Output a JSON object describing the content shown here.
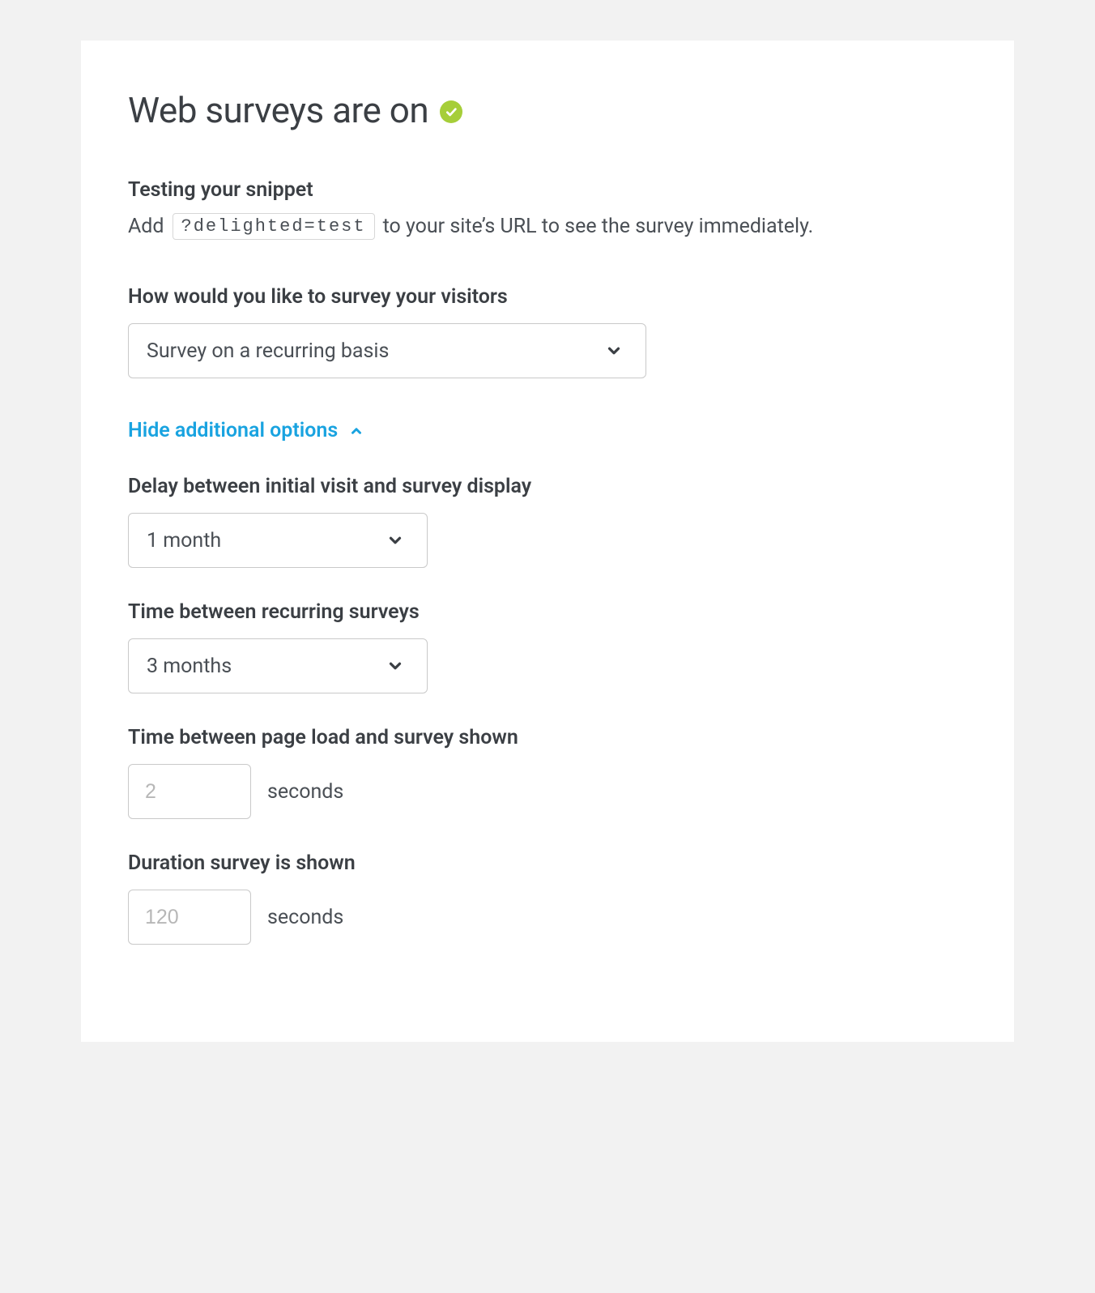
{
  "header": {
    "title": "Web surveys are on"
  },
  "testing": {
    "heading": "Testing your snippet",
    "prefix": "Add",
    "param": "?delighted=test",
    "suffix": "to your site’s URL to see the survey immediately."
  },
  "survey_method": {
    "label": "How would you like to survey your visitors",
    "value": "Survey on a recurring basis"
  },
  "toggle": {
    "label": "Hide additional options"
  },
  "delay_initial": {
    "label": "Delay between initial visit and survey display",
    "value": "1 month"
  },
  "recurring_gap": {
    "label": "Time between recurring surveys",
    "value": "3 months"
  },
  "page_load_delay": {
    "label": "Time between page load and survey shown",
    "placeholder": "2",
    "value": "",
    "unit": "seconds"
  },
  "duration_shown": {
    "label": "Duration survey is shown",
    "placeholder": "120",
    "value": "",
    "unit": "seconds"
  }
}
